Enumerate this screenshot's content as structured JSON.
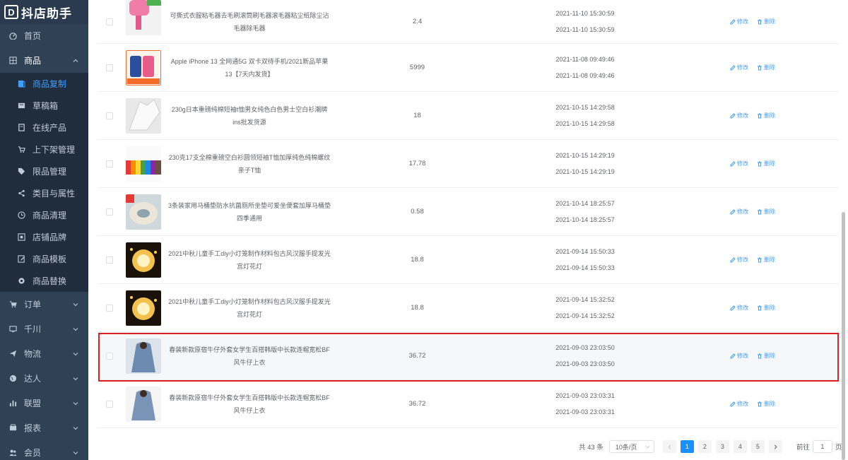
{
  "app": {
    "title": "抖店助手",
    "logo_letter": "D"
  },
  "sidebar": {
    "home": "首页",
    "products": "商品",
    "product_items": [
      "商品复制",
      "草稿箱",
      "在线产品",
      "上下架管理",
      "限品管理",
      "类目与属性",
      "商品清理",
      "店铺品牌",
      "商品模板",
      "商品替换"
    ],
    "others": [
      "订单",
      "千川",
      "物流",
      "达人",
      "联盟",
      "报表",
      "会员"
    ]
  },
  "table": {
    "rows": [
      {
        "title": "可撕式衣服粘毛器去毛刷滚筒刷毛器滚毛器粘尘纸除尘沾毛器除毛器",
        "price": "2.4",
        "time1": "2021-11-10 15:30:59",
        "time2": "2021-11-10 15:30:59"
      },
      {
        "title": "Apple iPhone 13 全网通5G 双卡双待手机/2021新品苹果13【7天内发货】",
        "price": "5999",
        "time1": "2021-11-08 09:49:46",
        "time2": "2021-11-08 09:49:46"
      },
      {
        "title": "230g日本重磅纯棉短袖t恤男女纯色白色男士空白衫潮牌ins批发货源",
        "price": "18",
        "time1": "2021-10-15 14:29:58",
        "time2": "2021-10-15 14:29:58"
      },
      {
        "title": "230克17支全棉重磅空白衫圆领短袖T恤加厚纯色纯棉螺纹亲子T恤",
        "price": "17.78",
        "time1": "2021-10-15 14:29:19",
        "time2": "2021-10-15 14:29:19"
      },
      {
        "title": "3条装家用马桶垫防水抗菌厕所坐垫可爱坐便套加厚马桶垫四季通用",
        "price": "0.58",
        "time1": "2021-10-14 18:25:57",
        "time2": "2021-10-14 18:25:57"
      },
      {
        "title": "2021中秋儿童手工diy小灯笼制作材料包古风汉服手提发光宫灯花灯",
        "price": "18.8",
        "time1": "2021-09-14 15:50:33",
        "time2": "2021-09-14 15:50:33"
      },
      {
        "title": "2021中秋儿童手工diy小灯笼制作材料包古风汉服手提发光宫灯花灯",
        "price": "18.8",
        "time1": "2021-09-14 15:32:52",
        "time2": "2021-09-14 15:32:52"
      },
      {
        "title": "春装新款原宿牛仔外套女学生百搭韩版中长款连帽宽松BF风牛仔上衣",
        "price": "36.72",
        "time1": "2021-09-03 23:03:50",
        "time2": "2021-09-03 23:03:50"
      },
      {
        "title": "春装新款原宿牛仔外套女学生百搭韩版中长款连帽宽松BF风牛仔上衣",
        "price": "36.72",
        "time1": "2021-09-03 23:03:31",
        "time2": "2021-09-03 23:03:31"
      }
    ],
    "edit_label": "修改",
    "delete_label": "删除"
  },
  "pagination": {
    "total": "共 43 条",
    "page_size": "10条/页",
    "pages": [
      "1",
      "2",
      "3",
      "4",
      "5"
    ],
    "jump_prefix": "前往",
    "jump_value": "1",
    "jump_suffix": "页"
  },
  "colors": {
    "sidebar_bg": "#304156",
    "accent": "#409eff",
    "highlight_border": "#e02020"
  }
}
